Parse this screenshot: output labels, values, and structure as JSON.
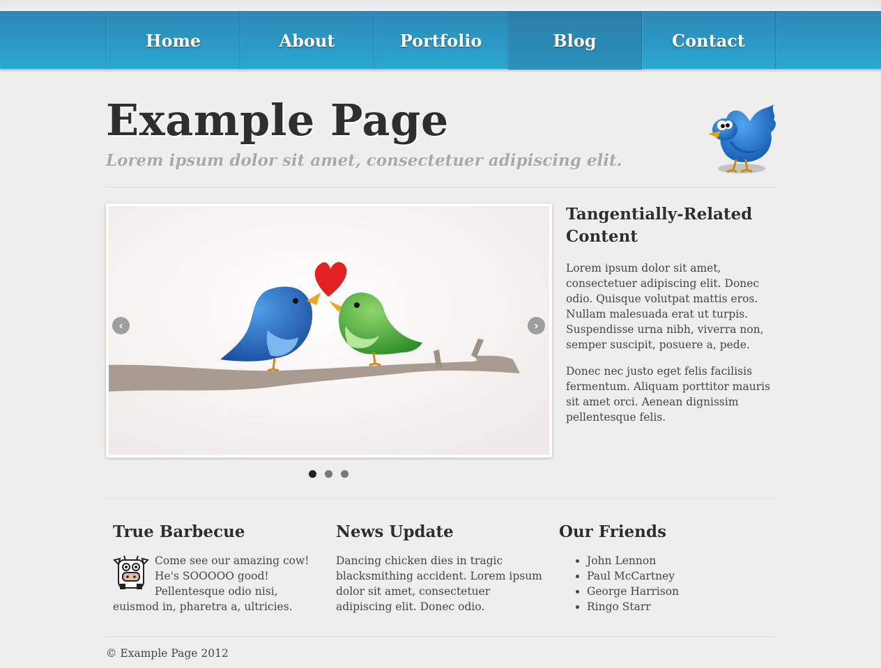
{
  "nav": {
    "items": [
      {
        "label": "Home",
        "active": false
      },
      {
        "label": "About",
        "active": false
      },
      {
        "label": "Portfolio",
        "active": false
      },
      {
        "label": "Blog",
        "active": true
      },
      {
        "label": "Contact",
        "active": false
      }
    ]
  },
  "header": {
    "title": "Example Page",
    "tagline": "Lorem ipsum dolor sit amet, consectetuer adipiscing elit.",
    "logo_icon": "twitter-bird-icon"
  },
  "slider": {
    "image_icon": "love-birds-illustration",
    "prev_label": "‹",
    "next_label": "›",
    "dots": 3,
    "active_dot": 0
  },
  "aside": {
    "title": "Tangentially-Related Content",
    "paragraphs": [
      "Lorem ipsum dolor sit amet, consectetuer adipiscing elit. Donec odio. Quisque volutpat mattis eros. Nullam malesuada erat ut turpis. Suspendisse urna nibh, viverra non, semper suscipit, posuere a, pede.",
      "Donec nec justo eget felis facilisis fermentum. Aliquam porttitor mauris sit amet orci. Aenean dignissim pellentesque felis."
    ]
  },
  "widgets": {
    "barbecue": {
      "title": "True Barbecue",
      "icon": "cow-icon",
      "text": "Come see our amazing cow! He's SOOOOO good! Pellentesque odio nisi, euismod in, pharetra a, ultricies."
    },
    "news": {
      "title": "News Update",
      "text": "Dancing chicken dies in tragic blacksmithing accident. Lorem ipsum dolor sit amet, consectetuer adipiscing elit. Donec odio."
    },
    "friends": {
      "title": "Our Friends",
      "items": [
        "John Lennon",
        "Paul McCartney",
        "George Harrison",
        "Ringo Starr"
      ]
    }
  },
  "footer": {
    "text": "© Example Page 2012"
  },
  "colors": {
    "nav_top": "#2d88b6",
    "nav_bottom": "#2aa7d0",
    "background": "#eeeeee",
    "heading": "#2e2e2e",
    "tagline": "#a9a9a9"
  }
}
